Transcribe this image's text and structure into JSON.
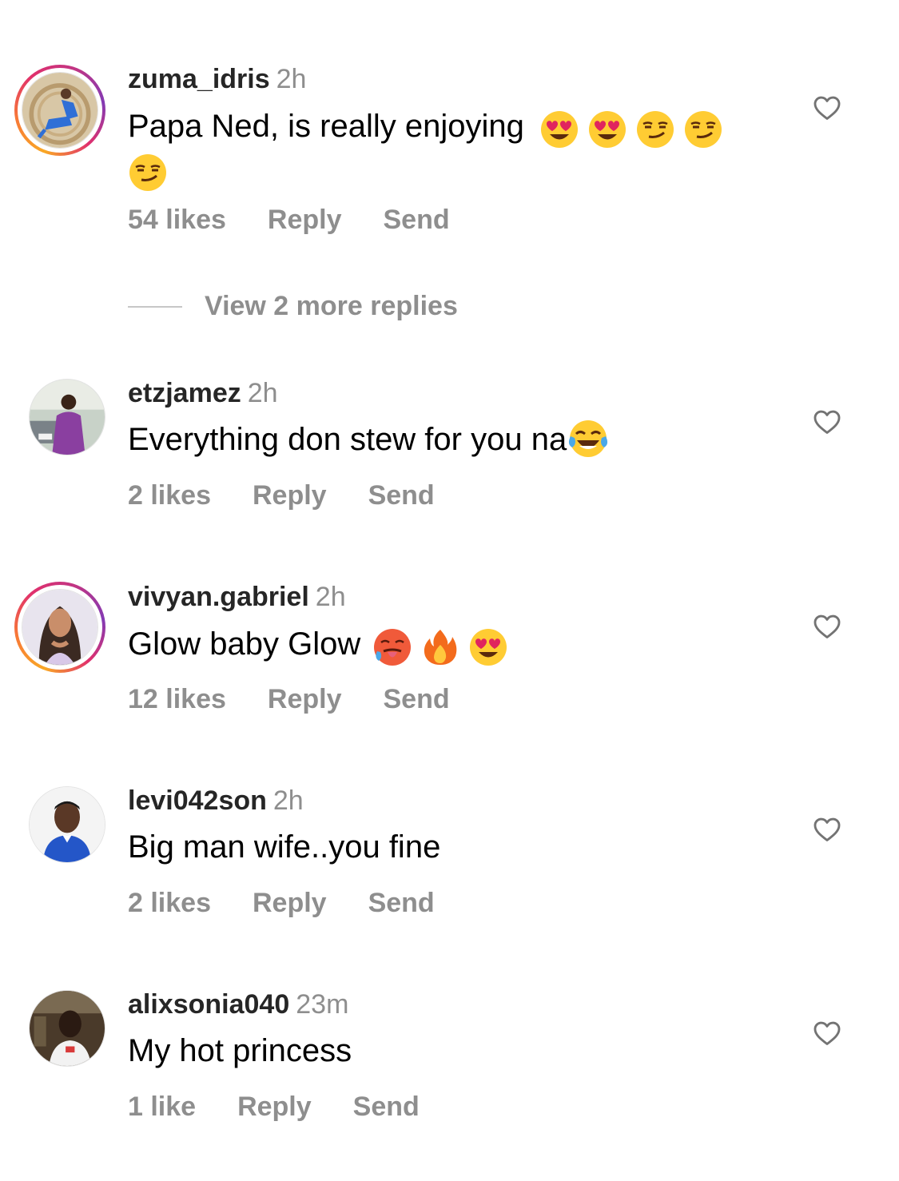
{
  "comments": [
    {
      "username": "zuma_idris",
      "time": "2h",
      "text": "Papa Ned, is really enjoying",
      "emojis": [
        "heart-eyes",
        "heart-eyes",
        "smirk",
        "smirk",
        "smirk"
      ],
      "likes": "54 likes",
      "reply": "Reply",
      "send": "Send",
      "story_ring": true
    },
    {
      "username": "etzjamez",
      "time": "2h",
      "text": "Everything don stew for you na",
      "emojis": [
        "tears-of-joy"
      ],
      "likes": "2 likes",
      "reply": "Reply",
      "send": "Send",
      "story_ring": false
    },
    {
      "username": "vivyan.gabriel",
      "time": "2h",
      "text": "Glow baby Glow",
      "emojis": [
        "hot-face",
        "fire",
        "heart-eyes"
      ],
      "likes": "12 likes",
      "reply": "Reply",
      "send": "Send",
      "story_ring": true
    },
    {
      "username": "levi042son",
      "time": "2h",
      "text": "Big man wife..you fine",
      "emojis": [],
      "likes": "2 likes",
      "reply": "Reply",
      "send": "Send",
      "story_ring": false
    },
    {
      "username": "alixsonia040",
      "time": "23m",
      "text": "My hot princess",
      "emojis": [],
      "likes": "1 like",
      "reply": "Reply",
      "send": "Send",
      "story_ring": false
    }
  ],
  "view_more_replies": "View 2 more replies",
  "icons": {
    "like": "heart-outline-icon"
  },
  "colors": {
    "secondary_text": "#8e8e8e",
    "primary_text": "#000000"
  }
}
